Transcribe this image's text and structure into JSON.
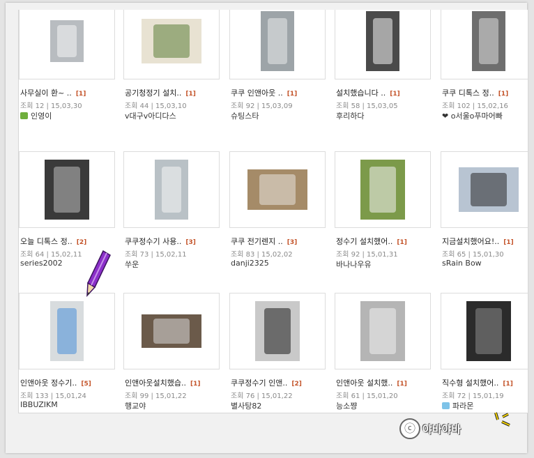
{
  "posts": [
    {
      "title": "사무실이 환~ ..",
      "comments": "[1]",
      "meta": "조회 12 | 15,03,30",
      "author": "인영이",
      "author_icon": "leaf-icon",
      "photo": {
        "w": 48,
        "h": 60,
        "tone": "#b8bcc0",
        "accent": "#f4f4f4"
      }
    },
    {
      "title": "공기청정기 설치..",
      "comments": "[1]",
      "meta": "조회 44 | 15,03,10",
      "author": "v대구v아디다스",
      "author_icon": "",
      "photo": {
        "w": 86,
        "h": 64,
        "tone": "#e8e2d2",
        "accent": "#5d7f3a"
      }
    },
    {
      "title": "쿠쿠 인앤아웃 ..",
      "comments": "[1]",
      "meta": "조회 92 | 15,03,09",
      "author": "슈팅스타",
      "author_icon": "",
      "photo": {
        "w": 48,
        "h": 86,
        "tone": "#9da4a8",
        "accent": "#e7e9ea"
      }
    },
    {
      "title": "설치했습니다 ..",
      "comments": "[1]",
      "meta": "조회 58 | 15,03,05",
      "author": "후리하다",
      "author_icon": "",
      "photo": {
        "w": 48,
        "h": 86,
        "tone": "#4a4a4a",
        "accent": "#f2f2f2"
      }
    },
    {
      "title": "쿠쿠 디톡스 정..",
      "comments": "[1]",
      "meta": "조회 102 | 15,02,16",
      "author": "❤ o서울o푸마어빠",
      "author_icon": "",
      "photo": {
        "w": 48,
        "h": 86,
        "tone": "#6e6e6e",
        "accent": "#dcdcdc"
      }
    },
    {
      "title": "오늘 디톡스 정..",
      "comments": "[2]",
      "meta": "조회 64 | 15,02,11",
      "author": "series2002",
      "author_icon": "",
      "photo": {
        "w": 64,
        "h": 86,
        "tone": "#3a3a3a",
        "accent": "#bcbcbc"
      }
    },
    {
      "title": "쿠쿠정수기 사용..",
      "comments": "[3]",
      "meta": "조회 73 | 15,02,11",
      "author": "쑤운",
      "author_icon": "",
      "photo": {
        "w": 48,
        "h": 86,
        "tone": "#b9c1c6",
        "accent": "#f5f5f5"
      }
    },
    {
      "title": "쿠쿠 전기렌지 ..",
      "comments": "[3]",
      "meta": "조회 83 | 15,02,02",
      "author": "danji2325",
      "author_icon": "",
      "photo": {
        "w": 86,
        "h": 58,
        "tone": "#a58b68",
        "accent": "#e8e4dc"
      }
    },
    {
      "title": "정수기 설치했어..",
      "comments": "[1]",
      "meta": "조회 92 | 15,01,31",
      "author": "바나나우유",
      "author_icon": "",
      "photo": {
        "w": 64,
        "h": 86,
        "tone": "#7c9a4a",
        "accent": "#f2f2f2"
      }
    },
    {
      "title": "지금설치했어요!..",
      "comments": "[1]",
      "meta": "조회 65 | 15,01,30",
      "author": "sRain Bow",
      "author_icon": "",
      "photo": {
        "w": 86,
        "h": 64,
        "tone": "#b8c4d2",
        "accent": "#2a2a2a"
      }
    },
    {
      "title": "인앤아웃 정수기..",
      "comments": "[5]",
      "meta": "조회 133 | 15,01,24",
      "author": "IBBUZIKM",
      "author_icon": "",
      "photo": {
        "w": 48,
        "h": 86,
        "tone": "#d8dcde",
        "accent": "#4b8fd8"
      }
    },
    {
      "title": "인앤아웃설치했습..",
      "comments": "[1]",
      "meta": "조회 99 | 15,01,22",
      "author": "행교야",
      "author_icon": "",
      "photo": {
        "w": 86,
        "h": 48,
        "tone": "#6b5a4a",
        "accent": "#d8d8d8"
      }
    },
    {
      "title": "쿠쿠정수기 인앤..",
      "comments": "[2]",
      "meta": "조회 76 | 15,01,22",
      "author": "별사탕82",
      "author_icon": "",
      "photo": {
        "w": 64,
        "h": 86,
        "tone": "#c9c9c9",
        "accent": "#1e1e1e"
      }
    },
    {
      "title": "인앤아웃 설치했..",
      "comments": "[1]",
      "meta": "조회 61 | 15,01,20",
      "author": "능소쨩",
      "author_icon": "",
      "photo": {
        "w": 64,
        "h": 86,
        "tone": "#b5b5b5",
        "accent": "#eeeeee"
      }
    },
    {
      "title": "직수형 설치했어..",
      "comments": "[1]",
      "meta": "조회 72 | 15,01,19",
      "author": "파라몬",
      "author_icon": "sky-icon",
      "photo": {
        "w": 64,
        "h": 86,
        "tone": "#2b2b2b",
        "accent": "#8a8a8a"
      }
    }
  ],
  "watermark": {
    "symbol": "ⓒ",
    "text": "야바야바"
  },
  "colors": {
    "comment": "#c4542a",
    "meta": "#8a8a8a",
    "pencil": "#8b2fc9"
  }
}
